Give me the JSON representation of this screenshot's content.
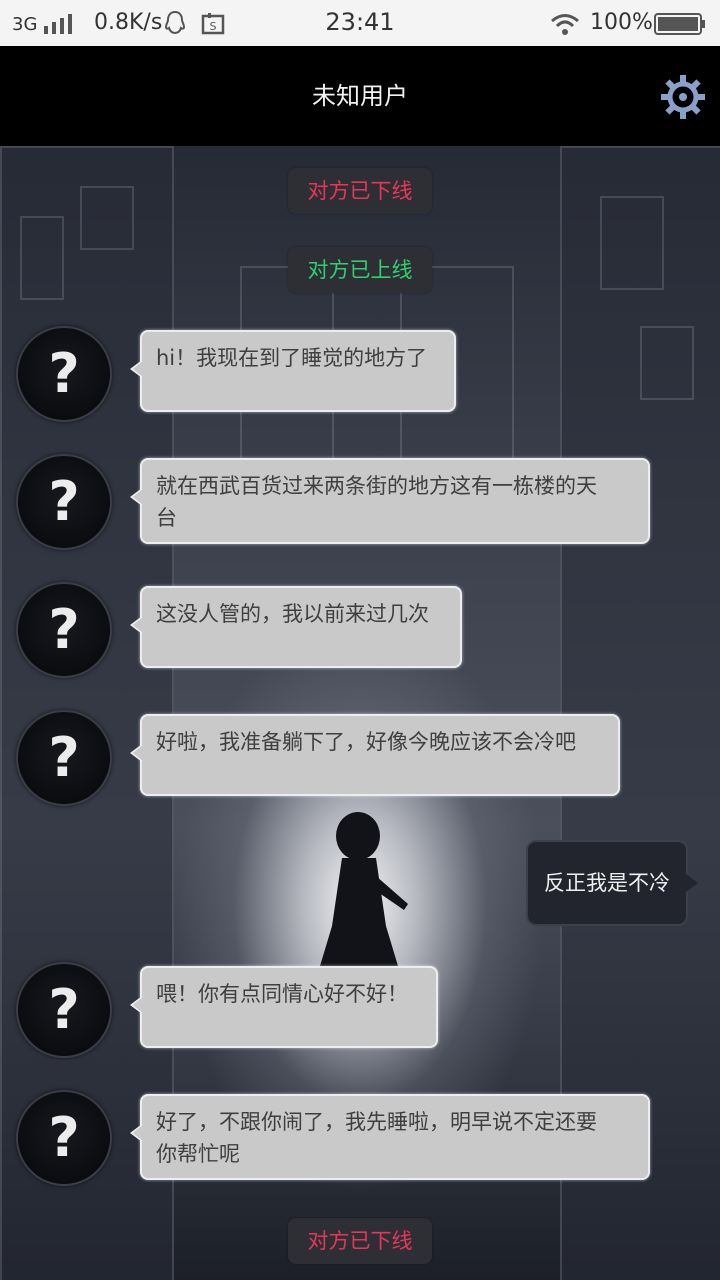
{
  "status_bar": {
    "network": "3G",
    "speed": "0.8K/s",
    "time": "23:41",
    "battery": "100%",
    "icons": [
      "signal-icon",
      "qq-icon",
      "screenshot-icon",
      "wifi-icon",
      "battery-icon"
    ]
  },
  "header": {
    "title": "未知用户",
    "settings_icon": "gear-icon",
    "accent_color": "#8aa0c8"
  },
  "chat": {
    "system_messages": [
      {
        "text": "对方已下线",
        "status": "offline",
        "color": "#e8365a"
      },
      {
        "text": "对方已上线",
        "status": "online",
        "color": "#2fd06e"
      },
      {
        "text": "对方已下线",
        "status": "offline",
        "color": "#e8365a"
      }
    ],
    "avatar_symbol": "?",
    "messages": [
      {
        "side": "left",
        "lines": [
          "hi！我现在到了睡觉的地方了"
        ]
      },
      {
        "side": "left",
        "lines": [
          "就在西武百货过来两条街的地方这有一栋楼的天",
          "台"
        ]
      },
      {
        "side": "left",
        "lines": [
          "这没人管的，我以前来过几次"
        ]
      },
      {
        "side": "left",
        "lines": [
          "好啦，我准备躺下了，好像今晚应该不会冷吧"
        ]
      },
      {
        "side": "right",
        "lines": [
          "反正我是不冷"
        ]
      },
      {
        "side": "left",
        "lines": [
          "喂！你有点同情心好不好！"
        ]
      },
      {
        "side": "left",
        "lines": [
          "好了，不跟你闹了，我先睡啦，明早说不定还要",
          "你帮忙呢"
        ]
      }
    ]
  }
}
